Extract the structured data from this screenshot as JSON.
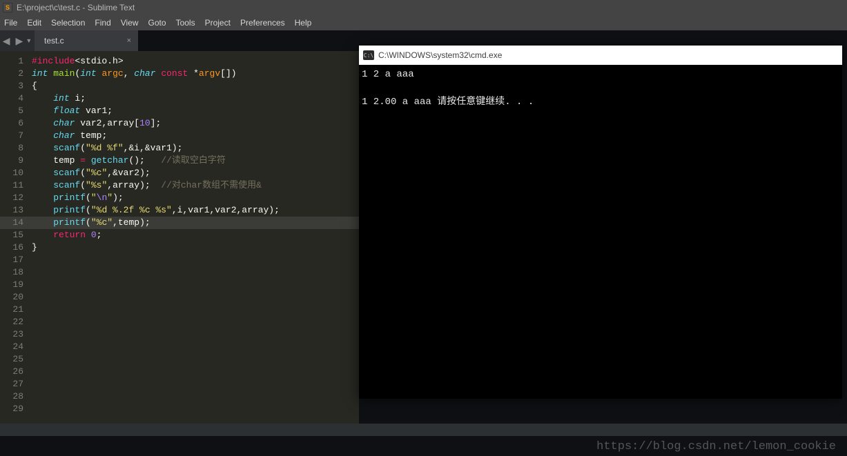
{
  "window": {
    "title": "E:\\project\\c\\test.c - Sublime Text",
    "app_icon_letter": "S"
  },
  "menu": [
    "File",
    "Edit",
    "Selection",
    "Find",
    "View",
    "Goto",
    "Tools",
    "Project",
    "Preferences",
    "Help"
  ],
  "sidectrl": {
    "left": "◀",
    "right": "▶",
    "down": "▼"
  },
  "tabs": [
    {
      "label": "test.c",
      "close": "×"
    }
  ],
  "code": {
    "lines": [
      {
        "n": 1,
        "segs": [
          {
            "c": "c-pre",
            "t": "#include"
          },
          {
            "t": "<stdio.h>"
          }
        ]
      },
      {
        "n": 2,
        "segs": [
          {
            "c": "c-kw",
            "t": "int"
          },
          {
            "t": " "
          },
          {
            "c": "c-fn",
            "t": "main"
          },
          {
            "t": "("
          },
          {
            "c": "c-kw",
            "t": "int"
          },
          {
            "t": " "
          },
          {
            "c": "c-param",
            "t": "argc"
          },
          {
            "t": ", "
          },
          {
            "c": "c-kw",
            "t": "char"
          },
          {
            "t": " "
          },
          {
            "c": "c-mod",
            "t": "const"
          },
          {
            "t": " *"
          },
          {
            "c": "c-param",
            "t": "argv"
          },
          {
            "t": "[])"
          }
        ]
      },
      {
        "n": 3,
        "segs": [
          {
            "t": "{"
          }
        ]
      },
      {
        "n": 4,
        "segs": [
          {
            "t": "    "
          },
          {
            "c": "c-kw",
            "t": "int"
          },
          {
            "t": " i;"
          }
        ]
      },
      {
        "n": 5,
        "segs": [
          {
            "t": "    "
          },
          {
            "c": "c-kw",
            "t": "float"
          },
          {
            "t": " var1;"
          }
        ]
      },
      {
        "n": 6,
        "segs": [
          {
            "t": "    "
          },
          {
            "c": "c-kw",
            "t": "char"
          },
          {
            "t": " var2,array["
          },
          {
            "c": "c-num",
            "t": "10"
          },
          {
            "t": "];"
          }
        ]
      },
      {
        "n": 7,
        "segs": [
          {
            "t": "    "
          },
          {
            "c": "c-kw",
            "t": "char"
          },
          {
            "t": " temp;"
          }
        ]
      },
      {
        "n": 8,
        "segs": [
          {
            "t": "    "
          },
          {
            "c": "c-builtin",
            "t": "scanf"
          },
          {
            "t": "("
          },
          {
            "c": "c-str",
            "t": "\"%d %f\""
          },
          {
            "t": ",&i,&var1);"
          }
        ]
      },
      {
        "n": 9,
        "segs": [
          {
            "t": "    temp "
          },
          {
            "c": "c-op",
            "t": "="
          },
          {
            "t": " "
          },
          {
            "c": "c-builtin",
            "t": "getchar"
          },
          {
            "t": "();   "
          },
          {
            "c": "c-cmt",
            "t": "//读取空白字符"
          }
        ]
      },
      {
        "n": 10,
        "segs": [
          {
            "t": "    "
          },
          {
            "c": "c-builtin",
            "t": "scanf"
          },
          {
            "t": "("
          },
          {
            "c": "c-str",
            "t": "\"%c\""
          },
          {
            "t": ",&var2);"
          }
        ]
      },
      {
        "n": 11,
        "segs": [
          {
            "t": "    "
          },
          {
            "c": "c-builtin",
            "t": "scanf"
          },
          {
            "t": "("
          },
          {
            "c": "c-str",
            "t": "\"%s\""
          },
          {
            "t": ",array);  "
          },
          {
            "c": "c-cmt",
            "t": "//对char数组不需使用&"
          }
        ]
      },
      {
        "n": 12,
        "segs": [
          {
            "t": "    "
          },
          {
            "c": "c-builtin",
            "t": "printf"
          },
          {
            "t": "("
          },
          {
            "c": "c-str",
            "t": "\""
          },
          {
            "c": "c-esc",
            "t": "\\n"
          },
          {
            "c": "c-str",
            "t": "\""
          },
          {
            "t": ");"
          }
        ]
      },
      {
        "n": 13,
        "segs": [
          {
            "t": "    "
          },
          {
            "c": "c-builtin",
            "t": "printf"
          },
          {
            "t": "("
          },
          {
            "c": "c-str",
            "t": "\"%d %.2f %c %s\""
          },
          {
            "t": ",i,var1,var2,array);"
          }
        ]
      },
      {
        "n": 14,
        "hl": true,
        "segs": [
          {
            "t": "    "
          },
          {
            "c": "c-builtin",
            "t": "printf"
          },
          {
            "t": "("
          },
          {
            "c": "c-str",
            "t": "\"%c\""
          },
          {
            "t": ",temp);"
          }
        ]
      },
      {
        "n": 15,
        "segs": [
          {
            "t": "    "
          },
          {
            "c": "c-mod",
            "t": "return"
          },
          {
            "t": " "
          },
          {
            "c": "c-num",
            "t": "0"
          },
          {
            "t": ";"
          }
        ]
      },
      {
        "n": 16,
        "segs": [
          {
            "t": "}"
          }
        ]
      },
      {
        "n": 17,
        "segs": []
      },
      {
        "n": 18,
        "segs": []
      },
      {
        "n": 19,
        "segs": []
      },
      {
        "n": 20,
        "segs": []
      },
      {
        "n": 21,
        "segs": []
      },
      {
        "n": 22,
        "segs": []
      },
      {
        "n": 23,
        "segs": []
      },
      {
        "n": 24,
        "segs": []
      },
      {
        "n": 25,
        "segs": []
      },
      {
        "n": 26,
        "segs": []
      },
      {
        "n": 27,
        "segs": []
      },
      {
        "n": 28,
        "segs": []
      },
      {
        "n": 29,
        "segs": []
      }
    ]
  },
  "cmd": {
    "title": "C:\\WINDOWS\\system32\\cmd.exe",
    "icon_text": "C:\\",
    "lines": [
      "1 2 a aaa",
      "",
      "1 2.00 a aaa 请按任意键继续. . ."
    ]
  },
  "watermark": "https://blog.csdn.net/lemon_cookie"
}
